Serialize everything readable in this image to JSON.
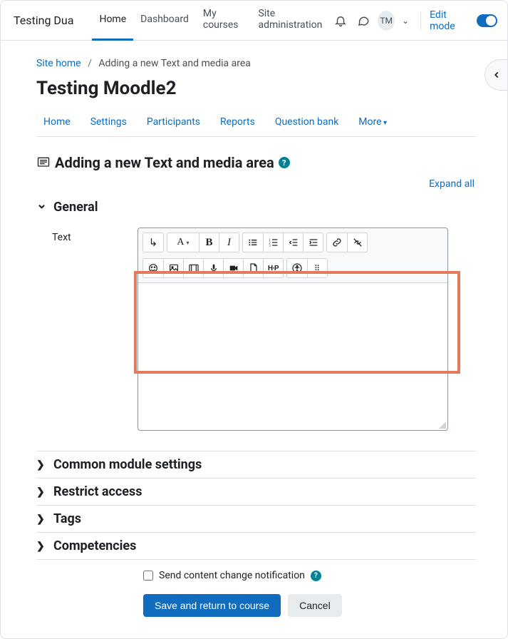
{
  "brand": "Testing Dua",
  "topnav": {
    "home": "Home",
    "dashboard": "Dashboard",
    "mycourses": "My courses",
    "siteadmin": "Site administration"
  },
  "user": {
    "initials": "TM"
  },
  "editmode_label": "Edit mode",
  "breadcrumb": {
    "site_home": "Site home",
    "current": "Adding a new Text and media area"
  },
  "course_title": "Testing Moodle2",
  "secnav": {
    "home": "Home",
    "settings": "Settings",
    "participants": "Participants",
    "reports": "Reports",
    "qbank": "Question bank",
    "more": "More"
  },
  "form_heading": "Adding a new Text and media area",
  "expand_all": "Expand all",
  "sections": {
    "general": "General",
    "common": "Common module settings",
    "restrict": "Restrict access",
    "tags": "Tags",
    "competencies": "Competencies"
  },
  "field_text_label": "Text",
  "toolbar": {
    "expand": "↓",
    "style": "A",
    "bold": "B",
    "italic": "I",
    "h5p": "H∙P"
  },
  "notif_label": "Send content change notification",
  "actions": {
    "save": "Save and return to course",
    "cancel": "Cancel"
  }
}
